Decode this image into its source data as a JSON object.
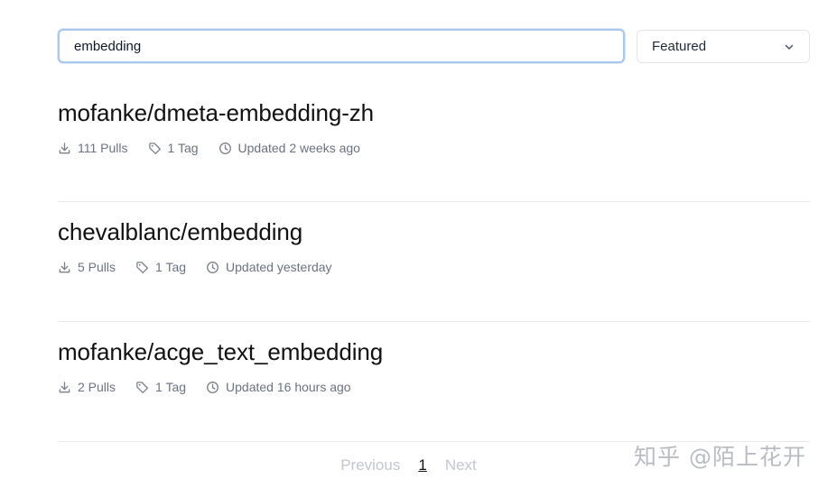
{
  "search": {
    "value": "embedding",
    "placeholder": ""
  },
  "sort": {
    "selected": "Featured",
    "icon": "chevron-down-icon"
  },
  "results": [
    {
      "title": "mofanke/dmeta-embedding-zh",
      "pulls": "111 Pulls",
      "tags": "1 Tag",
      "updated": "Updated 2 weeks ago"
    },
    {
      "title": "chevalblanc/embedding",
      "pulls": "5 Pulls",
      "tags": "1 Tag",
      "updated": "Updated yesterday"
    },
    {
      "title": "mofanke/acge_text_embedding",
      "pulls": "2 Pulls",
      "tags": "1 Tag",
      "updated": "Updated 16 hours ago"
    }
  ],
  "pagination": {
    "previous": "Previous",
    "current": "1",
    "next": "Next"
  },
  "watermark": "知乎 @陌上花开",
  "colors": {
    "focus_border": "#a8c7ee",
    "meta_text": "#6b7280",
    "disabled_text": "#c3c7cd"
  }
}
